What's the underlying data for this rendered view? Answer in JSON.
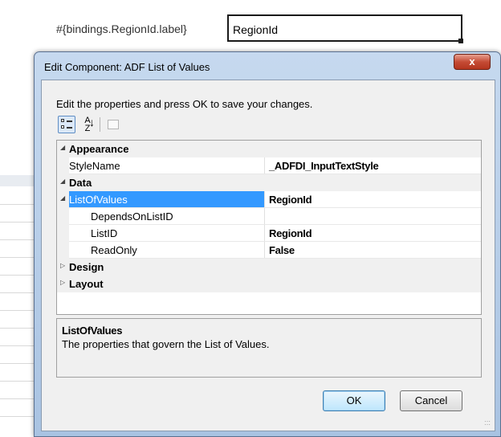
{
  "background": {
    "cell_label": "#{bindings.RegionId.label}",
    "cell_value": "RegionId"
  },
  "dialog": {
    "title": "Edit Component: ADF List of Values",
    "close_label": "x",
    "instruction": "Edit the properties and press OK to save your changes.",
    "toolbar": {
      "categorized": "categorized-icon",
      "alphabetical": "alphabetical-sort-icon",
      "property_pages": "property-pages-icon"
    },
    "property_grid": {
      "rows": [
        {
          "type": "category",
          "label": "Appearance",
          "expanded": true,
          "value": ""
        },
        {
          "type": "property",
          "label": "StyleName",
          "value": "_ADFDI_InputTextStyle"
        },
        {
          "type": "category",
          "label": "Data",
          "expanded": true,
          "value": ""
        },
        {
          "type": "property-group",
          "label": "ListOfValues",
          "value": "RegionId",
          "selected": true
        },
        {
          "type": "sub",
          "label": "DependsOnListID",
          "value": ""
        },
        {
          "type": "sub",
          "label": "ListID",
          "value": "RegionId"
        },
        {
          "type": "sub",
          "label": "ReadOnly",
          "value": "False"
        },
        {
          "type": "category",
          "label": "Design",
          "expanded": false,
          "value": ""
        },
        {
          "type": "category",
          "label": "Layout",
          "expanded": false,
          "value": ""
        }
      ]
    },
    "description": {
      "title": "ListOfValues",
      "text": "The properties that govern the List of Values."
    },
    "buttons": {
      "ok": "OK",
      "cancel": "Cancel"
    }
  },
  "colors": {
    "selection": "#3399ff",
    "title_gradient_top": "#c6d9ef",
    "close_button": "#c54b35"
  }
}
